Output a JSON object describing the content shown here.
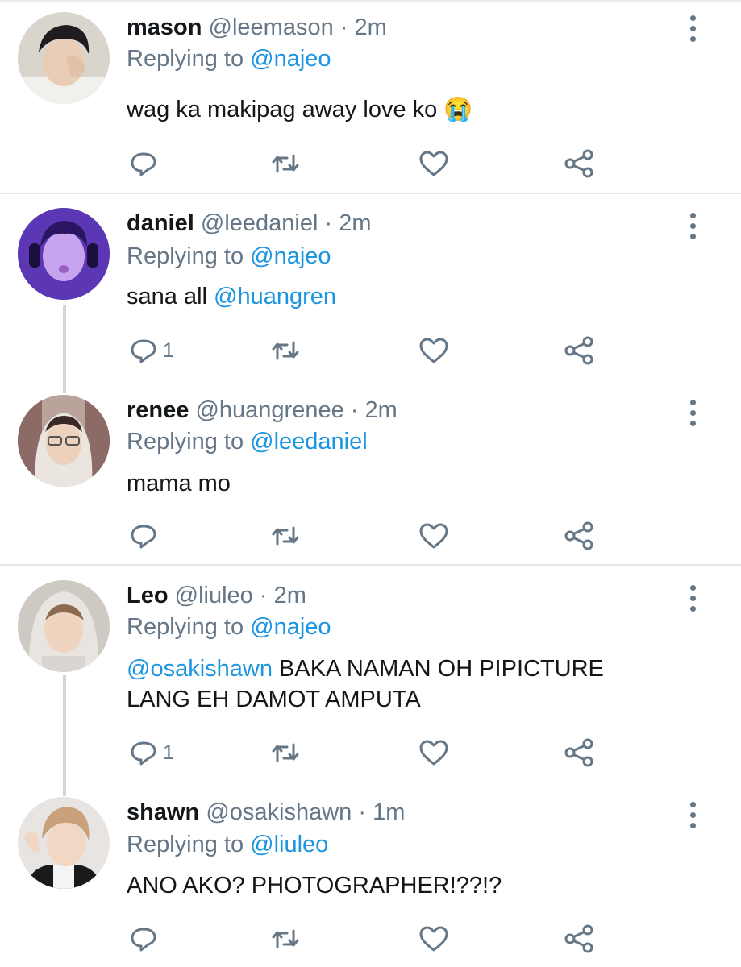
{
  "tweets": [
    {
      "name": "mason",
      "handle": "@leemason",
      "dot": "·",
      "time": "2m",
      "replying_prefix": "Replying to",
      "replying_to": "@najeo",
      "text": "wag ka makipag away love ko 😭",
      "reply_count": ""
    },
    {
      "name": "daniel",
      "handle": "@leedaniel",
      "dot": "·",
      "time": "2m",
      "replying_prefix": "Replying to",
      "replying_to": "@najeo",
      "text_prefix": "sana all",
      "text_mention": "@huangren",
      "reply_count": "1"
    },
    {
      "name": "renee",
      "handle": "@huangrenee",
      "dot": "·",
      "time": "2m",
      "replying_prefix": "Replying to",
      "replying_to": "@leedaniel",
      "text": "mama mo",
      "reply_count": ""
    },
    {
      "name": "Leo",
      "handle": "@liuleo",
      "dot": "·",
      "time": "2m",
      "replying_prefix": "Replying to",
      "replying_to": "@najeo",
      "text_mention": "@osakishawn",
      "text_line1": "BAKA NAMAN OH PIPICTURE",
      "text_line2": "LANG EH DAMOT AMPUTA",
      "reply_count": "1"
    },
    {
      "name": "shawn",
      "handle": "@osakishawn",
      "dot": "·",
      "time": "1m",
      "replying_prefix": "Replying to",
      "replying_to": "@liuleo",
      "text": "ANO AKO? PHOTOGRAPHER!??!?",
      "reply_count": ""
    }
  ],
  "icons": [
    "reply-icon",
    "retweet-icon",
    "like-icon",
    "share-icon",
    "more-options-icon"
  ],
  "colors": {
    "link": "#1b95e0",
    "secondary": "#657786",
    "text": "#14171a",
    "divider": "#e1e8ed",
    "thread": "#ccd6dd"
  }
}
